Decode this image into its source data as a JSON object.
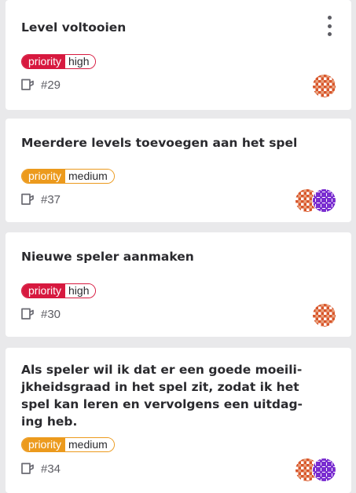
{
  "cards": [
    {
      "title": "Level voltooien",
      "priority_key": "priority",
      "priority_value": "high",
      "issue_number": "#29",
      "has_menu": true
    },
    {
      "title": "Meerdere levels toevoegen aan het spel",
      "priority_key": "priority",
      "priority_value": "medium",
      "issue_number": "#37"
    },
    {
      "title": "Nieuwe speler aanmaken",
      "priority_key": "priority",
      "priority_value": "high",
      "issue_number": "#30"
    },
    {
      "title": "Als speler wil ik dat er een goede moeili-jkheidsgraad in het spel zit, zodat ik het spel kan leren en vervolgens een uitdag-ing heb.",
      "title_lines": [
        "Als speler wil ik dat er een goede moeili-",
        "jkheidsgraad in het spel zit, zodat ik het",
        "spel kan leren en vervolgens een uitdag-",
        "ing heb."
      ],
      "priority_key": "priority",
      "priority_value": "medium",
      "issue_number": "#34"
    }
  ],
  "colors": {
    "priority_high": "#d7193f",
    "priority_medium": "#ec9a1d",
    "avatar_orange": "#d8552a",
    "avatar_purple": "#7a2ed0",
    "board_background": "#e9e9eb"
  },
  "icons": {
    "issue": "issue-opened-icon",
    "menu": "more-vertical-icon",
    "avatar": "identicon-avatar"
  }
}
